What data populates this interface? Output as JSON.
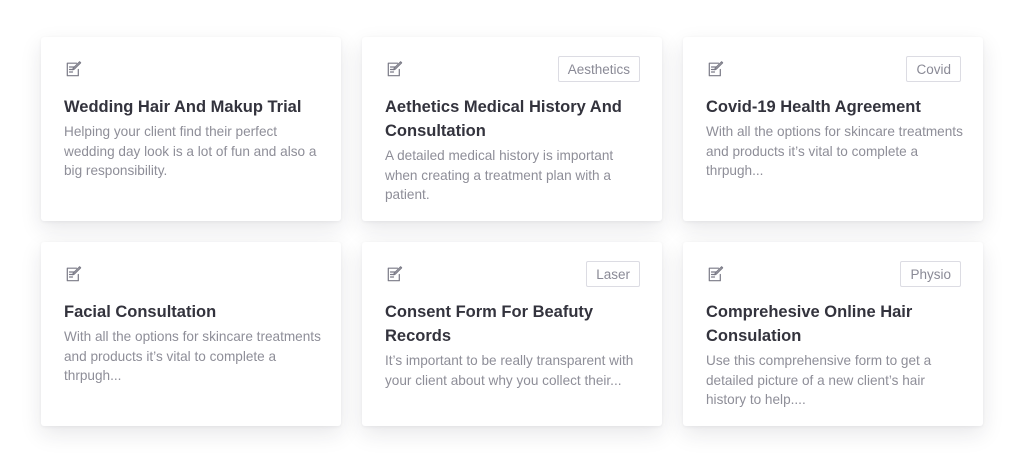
{
  "cards": [
    {
      "title": "Wedding Hair And Makup Trial",
      "description": "Helping your client find their perfect wedding day look is a lot of fun and also a big responsibility.",
      "tag": ""
    },
    {
      "title": "Aethetics Medical History And Consultation",
      "description": "A detailed medical history is important when creating a treatment plan with a patient.",
      "tag": "Aesthetics"
    },
    {
      "title": "Covid-19 Health Agreement",
      "description": "With all the options for skincare treatments and products it’s vital to complete a thrpugh...",
      "tag": "Covid"
    },
    {
      "title": "Facial Consultation",
      "description": "With all the options for skincare treatments and products it’s vital to complete a thrpugh...",
      "tag": ""
    },
    {
      "title": "Consent Form For Beafuty Records",
      "description": "It’s important to be really transparent with your client about why you collect their...",
      "tag": "Laser"
    },
    {
      "title": "Comprehesive Online Hair Consulation",
      "description": "Use this comprehensive form to get a detailed picture of a new client’s hair history to help....",
      "tag": "Physio"
    }
  ],
  "icon": "form-edit-icon",
  "colors": {
    "title": "#33333d",
    "description": "#8e8e98",
    "tag_border": "#dcdce3",
    "icon": "#7a7a86"
  }
}
